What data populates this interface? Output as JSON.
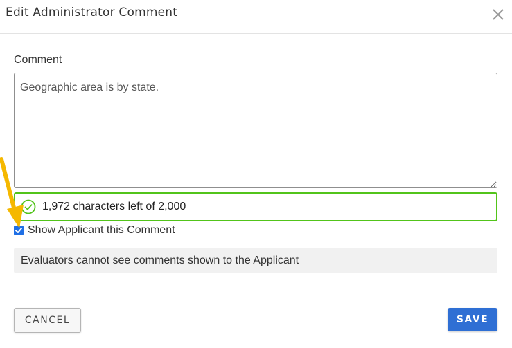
{
  "dialog": {
    "title": "Edit Administrator Comment",
    "close_icon": "close-icon"
  },
  "comment": {
    "label": "Comment",
    "value": "Geographic area is by state."
  },
  "char_counter": {
    "text": "1,972 characters left of 2,000",
    "icon": "check-circle-icon",
    "color": "#52c41a"
  },
  "show_applicant": {
    "label": "Show Applicant this Comment",
    "checked": true
  },
  "notice": {
    "text": "Evaluators cannot see comments shown to the Applicant"
  },
  "buttons": {
    "cancel_label": "CANCEL",
    "save_label": "SAVE"
  },
  "colors": {
    "primary": "#2f6fd4",
    "success": "#52c41a",
    "annotation_arrow": "#f5b800"
  }
}
